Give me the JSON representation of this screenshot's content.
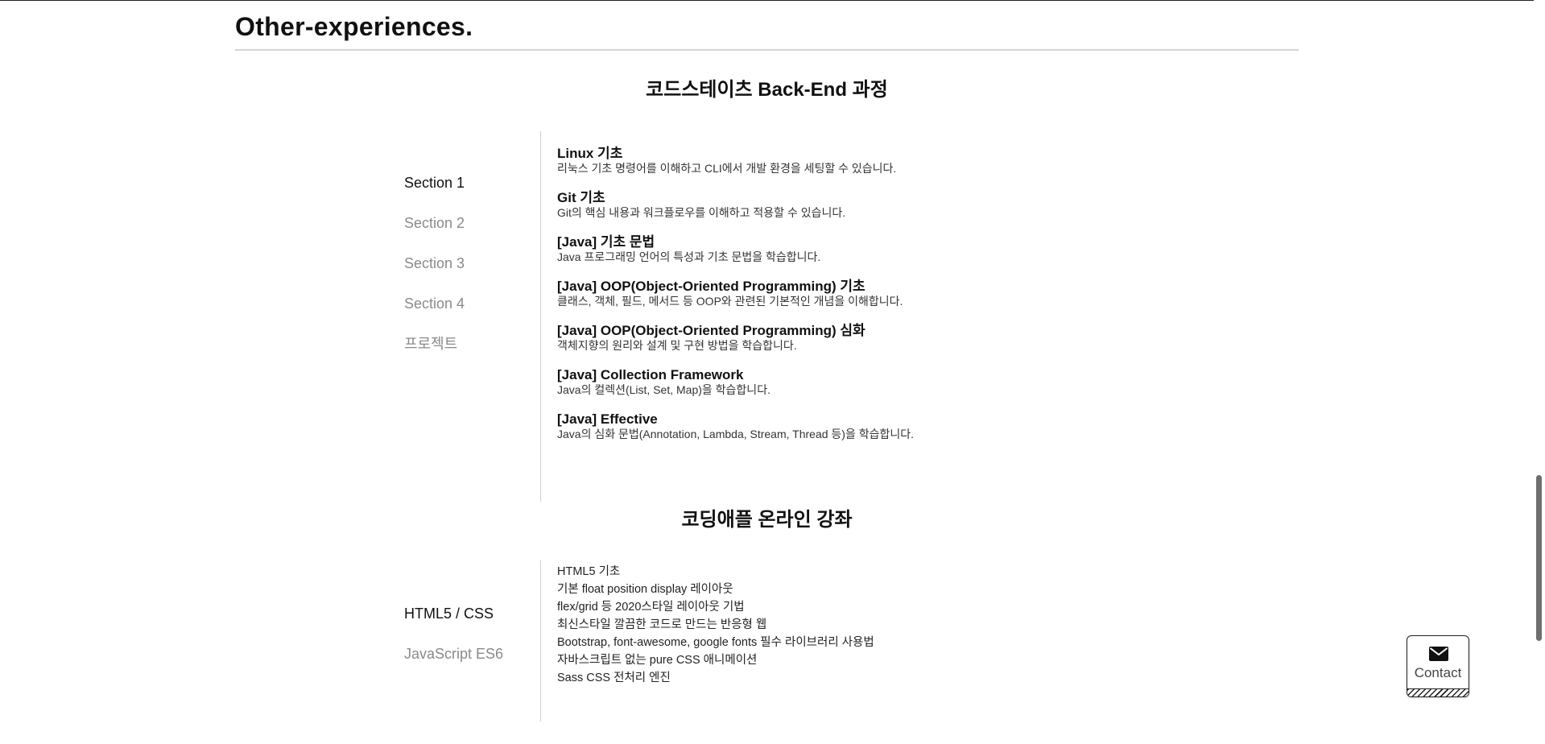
{
  "section_heading": "Other-experiences.",
  "courses": [
    {
      "title": "코드스테이츠 Back-End 과정",
      "tabs": [
        "Section 1",
        "Section 2",
        "Section 3",
        "Section 4",
        "프로젝트"
      ],
      "active_tab": 0,
      "items": [
        {
          "title": "Linux 기초",
          "desc": "리눅스 기초 명령어를 이해하고 CLI에서 개발 환경을 세팅할 수 있습니다."
        },
        {
          "title": "Git 기초",
          "desc": "Git의 핵심 내용과 워크플로우를 이해하고 적용할 수 있습니다."
        },
        {
          "title": "[Java] 기초 문법",
          "desc": "Java 프로그래밍 언어의 특성과 기초 문법을 학습합니다."
        },
        {
          "title": "[Java] OOP(Object-Oriented Programming) 기초",
          "desc": "클래스, 객체, 필드, 메서드 등 OOP와 관련된 기본적인 개념을 이해합니다."
        },
        {
          "title": "[Java] OOP(Object-Oriented Programming) 심화",
          "desc": "객체지향의 원리와 설계 및 구현 방법을 학습합니다."
        },
        {
          "title": "[Java] Collection Framework",
          "desc": "Java의 컬렉션(List, Set, Map)을 학습합니다."
        },
        {
          "title": "[Java] Effective",
          "desc": "Java의 심화 문법(Annotation, Lambda, Stream, Thread 등)을 학습합니다."
        }
      ]
    },
    {
      "title": "코딩애플 온라인 강좌",
      "tabs": [
        "HTML5 / CSS",
        "JavaScript ES6"
      ],
      "active_tab": 0,
      "bullets": [
        "HTML5 기초",
        "기본 float position display 레이아웃",
        "flex/grid 등 2020스타일 레이아웃 기법",
        "최신스타일 깔끔한 코드로 만드는 반응형 웹",
        "Bootstrap, font-awesome, google fonts 필수 라이브러리 사용법",
        "자바스크립트 없는 pure CSS 애니메이션",
        "Sass CSS 전처리 엔진"
      ]
    }
  ],
  "contact": {
    "label": "Contact",
    "icon": "mail-icon"
  },
  "colors": {
    "text": "#111111",
    "muted": "#8a8a8a",
    "rule": "#d4d4d4"
  }
}
